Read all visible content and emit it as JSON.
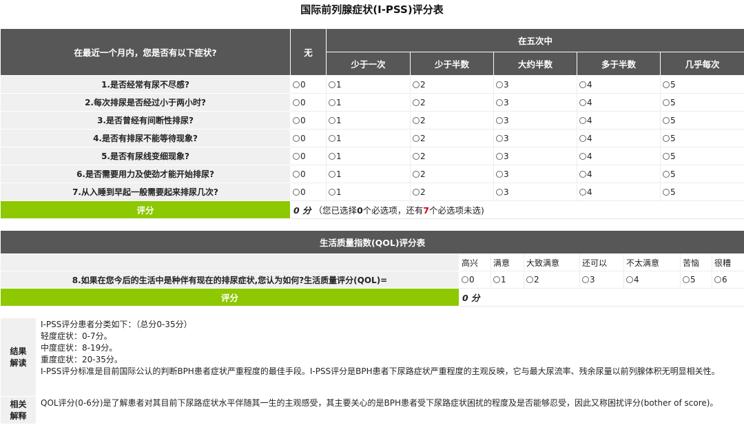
{
  "title": "国际前列腺症状(I-PSS)评分表",
  "ipss": {
    "question_header": "在最近一个月内，您是否有以下症状?",
    "none_header": "无",
    "group_header": "在五次中",
    "freq_headers": [
      "少于一次",
      "少于半数",
      "大约半数",
      "多于半数",
      "几乎每次"
    ],
    "questions": [
      "1.是否经常有尿不尽感?",
      "2.每次排尿是否经过小于两小时?",
      "3.是否曾经有间断性排尿?",
      "4.是否有排尿不能等待现象?",
      "5.是否有尿线变细现象?",
      "6.是否需要用力及使劲才能开始排尿?",
      "7.从入睡到早起一般需要起来排尿几次?"
    ],
    "options": [
      "0",
      "1",
      "2",
      "3",
      "4",
      "5"
    ],
    "score_label": "评分",
    "score_value": "0 分",
    "score_note_a": "（您已选择",
    "selected_count": "0",
    "score_note_b": "个必选项，还有",
    "remaining_count": "7",
    "score_note_c": "个必选项未选)"
  },
  "qol": {
    "section_title": "生活质量指数(QOL)评分表",
    "headers": [
      "高兴",
      "满意",
      "大致满意",
      "还可以",
      "不太满意",
      "苦恼",
      "很糟"
    ],
    "question": "8.如果在您今后的生活中是种伴有现在的排尿症状,您认为如何?生活质量评分(QOL)=",
    "options": [
      "0",
      "1",
      "2",
      "3",
      "4",
      "5",
      "6"
    ],
    "score_label": "评分",
    "score_value": "0 分"
  },
  "interpretation": {
    "label": "结果解读",
    "lines": [
      "I-PSS评分患者分类如下：（总分0-35分）",
      "轻度症状：0-7分。",
      "中度症状：8-19分。",
      "重度症状：20-35分。",
      "I-PSS评分标准是目前国际公认的判断BPH患者症状严重程度的最佳手段。I-PSS评分是BPH患者下尿路症状严重程度的主观反映，它与最大尿流率、残余尿量以前列腺体积无明显相关性。"
    ]
  },
  "related": {
    "label": "相关解释",
    "text": "QOL评分(0-6分)是了解患者对其目前下尿路症状水平伴随其一生的主观感受，其主要关心的是BPH患者受下尿路症状困扰的程度及是否能够忍受，因此又称困扰评分(bother of score)。"
  }
}
